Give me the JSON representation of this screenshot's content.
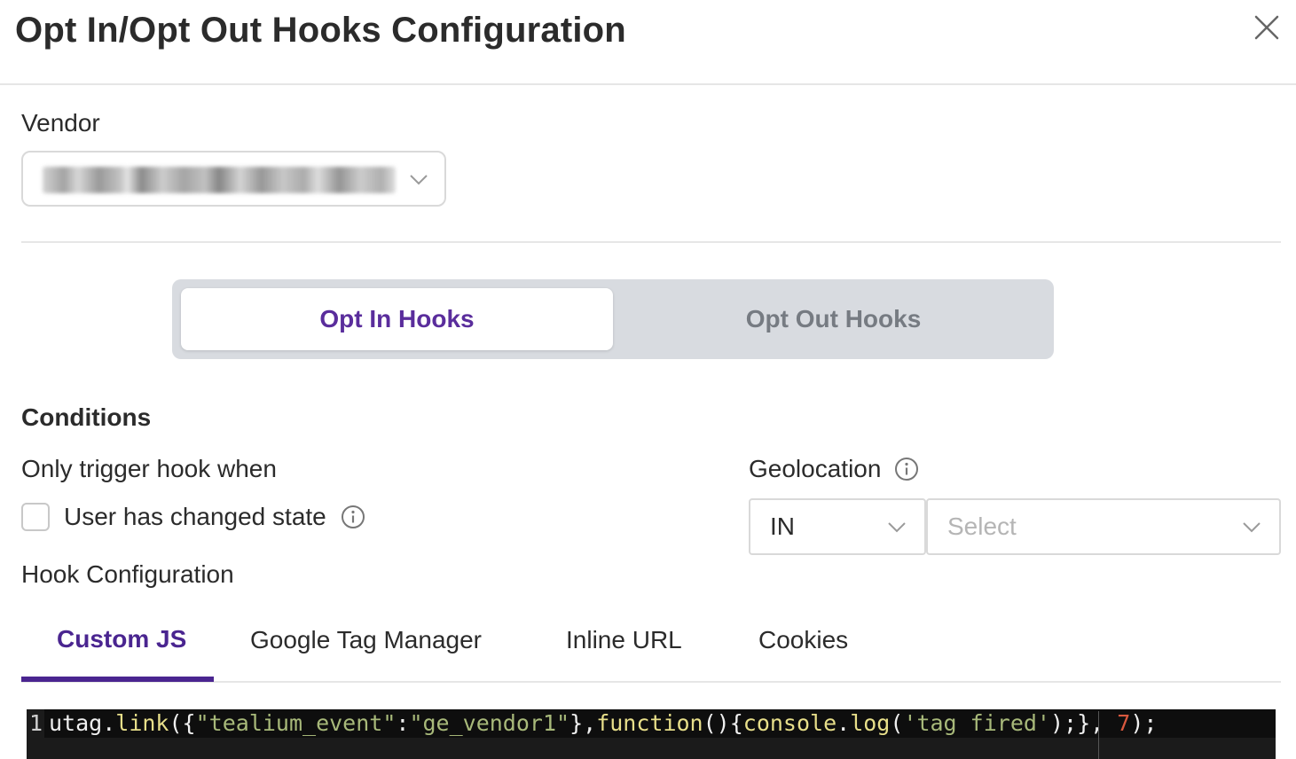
{
  "dialog": {
    "title": "Opt In/Opt Out Hooks Configuration"
  },
  "vendor": {
    "label": "Vendor",
    "value_obscured": true
  },
  "hook_toggle": {
    "options": [
      "Opt In Hooks",
      "Opt Out Hooks"
    ],
    "selected": "Opt In Hooks"
  },
  "conditions": {
    "title": "Conditions",
    "trigger_label": "Only trigger hook when",
    "checkbox_label": "User has changed state",
    "checkbox_checked": false
  },
  "geolocation": {
    "label": "Geolocation",
    "operator_value": "IN",
    "region_placeholder": "Select"
  },
  "hook_configuration": {
    "label": "Hook Configuration",
    "tabs": [
      "Custom JS",
      "Google Tag Manager",
      "Inline URL",
      "Cookies"
    ],
    "active_tab": "Custom JS"
  },
  "code_editor": {
    "line_number": "1",
    "tokens": [
      {
        "text": "utag",
        "color": "#f0f0f0"
      },
      {
        "text": ".",
        "color": "#f0f0f0"
      },
      {
        "text": "link",
        "color": "#e8df8a"
      },
      {
        "text": "({",
        "color": "#f0f0f0"
      },
      {
        "text": "\"tealium_event\"",
        "color": "#a8b97a"
      },
      {
        "text": ":",
        "color": "#f0f0f0"
      },
      {
        "text": "\"ge_vendor1\"",
        "color": "#a8b97a"
      },
      {
        "text": "},",
        "color": "#f0f0f0"
      },
      {
        "text": "function",
        "color": "#e8df8a"
      },
      {
        "text": "(){",
        "color": "#f0f0f0"
      },
      {
        "text": "console",
        "color": "#e8df8a"
      },
      {
        "text": ".",
        "color": "#f0f0f0"
      },
      {
        "text": "log",
        "color": "#e8df8a"
      },
      {
        "text": "(",
        "color": "#f0f0f0"
      },
      {
        "text": "'tag fired'",
        "color": "#a8b97a"
      },
      {
        "text": ");}, ",
        "color": "#f0f0f0"
      },
      {
        "text": "7",
        "color": "#d9583e"
      },
      {
        "text": ");",
        "color": "#f0f0f0"
      }
    ]
  },
  "colors": {
    "accent_purple": "#5a2d9c",
    "tab_active": "#4a2590",
    "segment_bg": "#d8dbe0",
    "editor_bg": "#1b1b1b"
  }
}
